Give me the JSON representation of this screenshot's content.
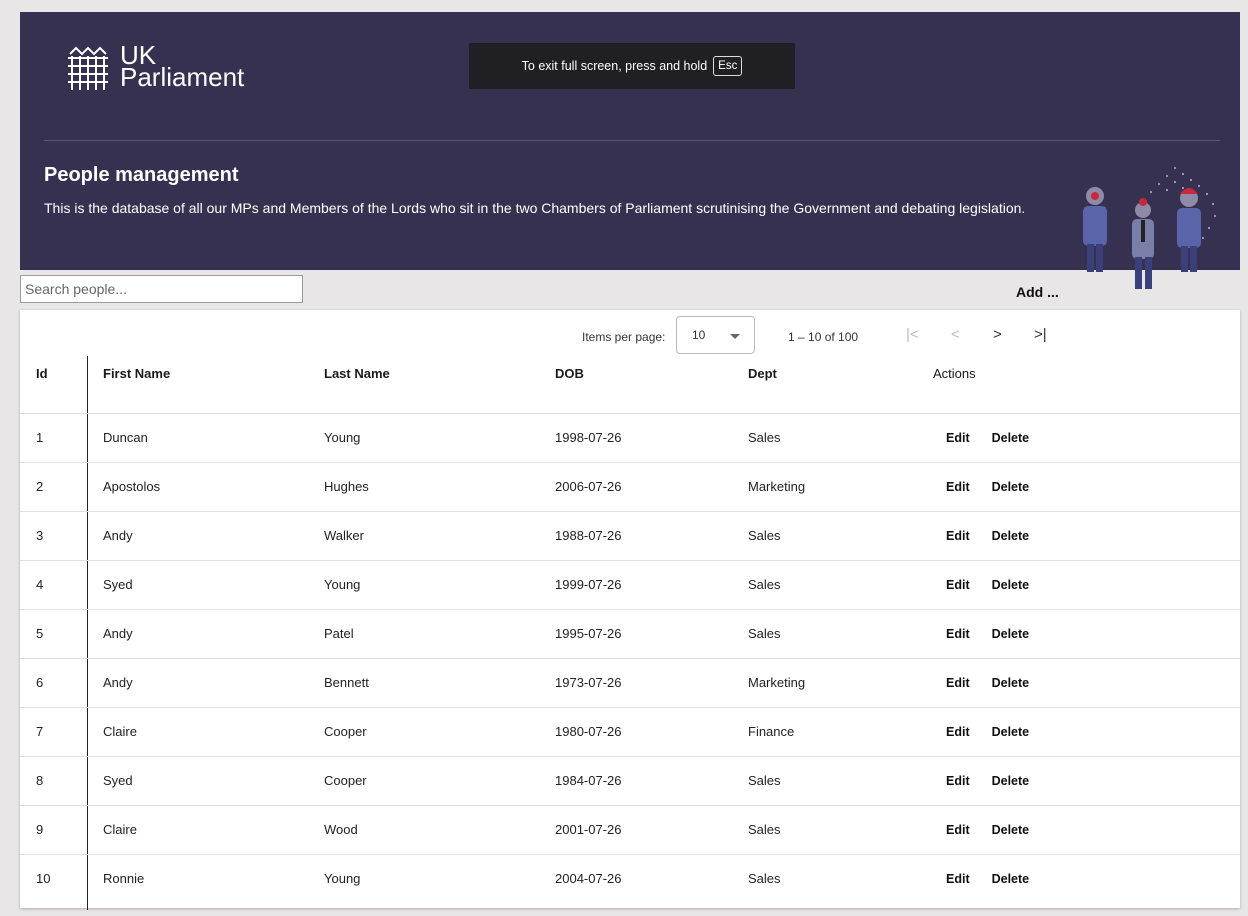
{
  "header": {
    "logo_line1": "UK",
    "logo_line2": "Parliament",
    "title": "People management",
    "description": "This is the database of all our MPs and Members of the Lords who sit in the two Chambers of Parliament scrutinising the Government and debating legislation."
  },
  "fullscreen_notice": {
    "text": "To exit full screen, press and hold",
    "key": "Esc"
  },
  "search": {
    "placeholder": "Search people..."
  },
  "toolbar": {
    "add_label": "Add ..."
  },
  "paginator": {
    "items_per_page_label": "Items per page:",
    "page_size": "10",
    "range": "1 – 10 of 100",
    "first_icon": "first-page-icon",
    "prev_icon": "chevron-left-icon",
    "next_icon": "chevron-right-icon",
    "last_icon": "last-page-icon"
  },
  "table": {
    "headers": {
      "id": "Id",
      "first": "First Name",
      "last": "Last Name",
      "dob": "DOB",
      "dept": "Dept",
      "actions": "Actions"
    },
    "action_labels": {
      "edit": "Edit",
      "delete": "Delete"
    },
    "rows": [
      {
        "id": "1",
        "first": "Duncan",
        "last": "Young",
        "dob": "1998-07-26",
        "dept": "Sales"
      },
      {
        "id": "2",
        "first": "Apostolos",
        "last": "Hughes",
        "dob": "2006-07-26",
        "dept": "Marketing"
      },
      {
        "id": "3",
        "first": "Andy",
        "last": "Walker",
        "dob": "1988-07-26",
        "dept": "Sales"
      },
      {
        "id": "4",
        "first": "Syed",
        "last": "Young",
        "dob": "1999-07-26",
        "dept": "Sales"
      },
      {
        "id": "5",
        "first": "Andy",
        "last": "Patel",
        "dob": "1995-07-26",
        "dept": "Sales"
      },
      {
        "id": "6",
        "first": "Andy",
        "last": "Bennett",
        "dob": "1973-07-26",
        "dept": "Marketing"
      },
      {
        "id": "7",
        "first": "Claire",
        "last": "Cooper",
        "dob": "1980-07-26",
        "dept": "Finance"
      },
      {
        "id": "8",
        "first": "Syed",
        "last": "Cooper",
        "dob": "1984-07-26",
        "dept": "Sales"
      },
      {
        "id": "9",
        "first": "Claire",
        "last": "Wood",
        "dob": "2001-07-26",
        "dept": "Sales"
      },
      {
        "id": "10",
        "first": "Ronnie",
        "last": "Young",
        "dob": "2004-07-26",
        "dept": "Sales"
      }
    ]
  },
  "colors": {
    "banner": "#373151",
    "page_bg": "#e8e6e6",
    "accent_red": "#c8283c"
  }
}
